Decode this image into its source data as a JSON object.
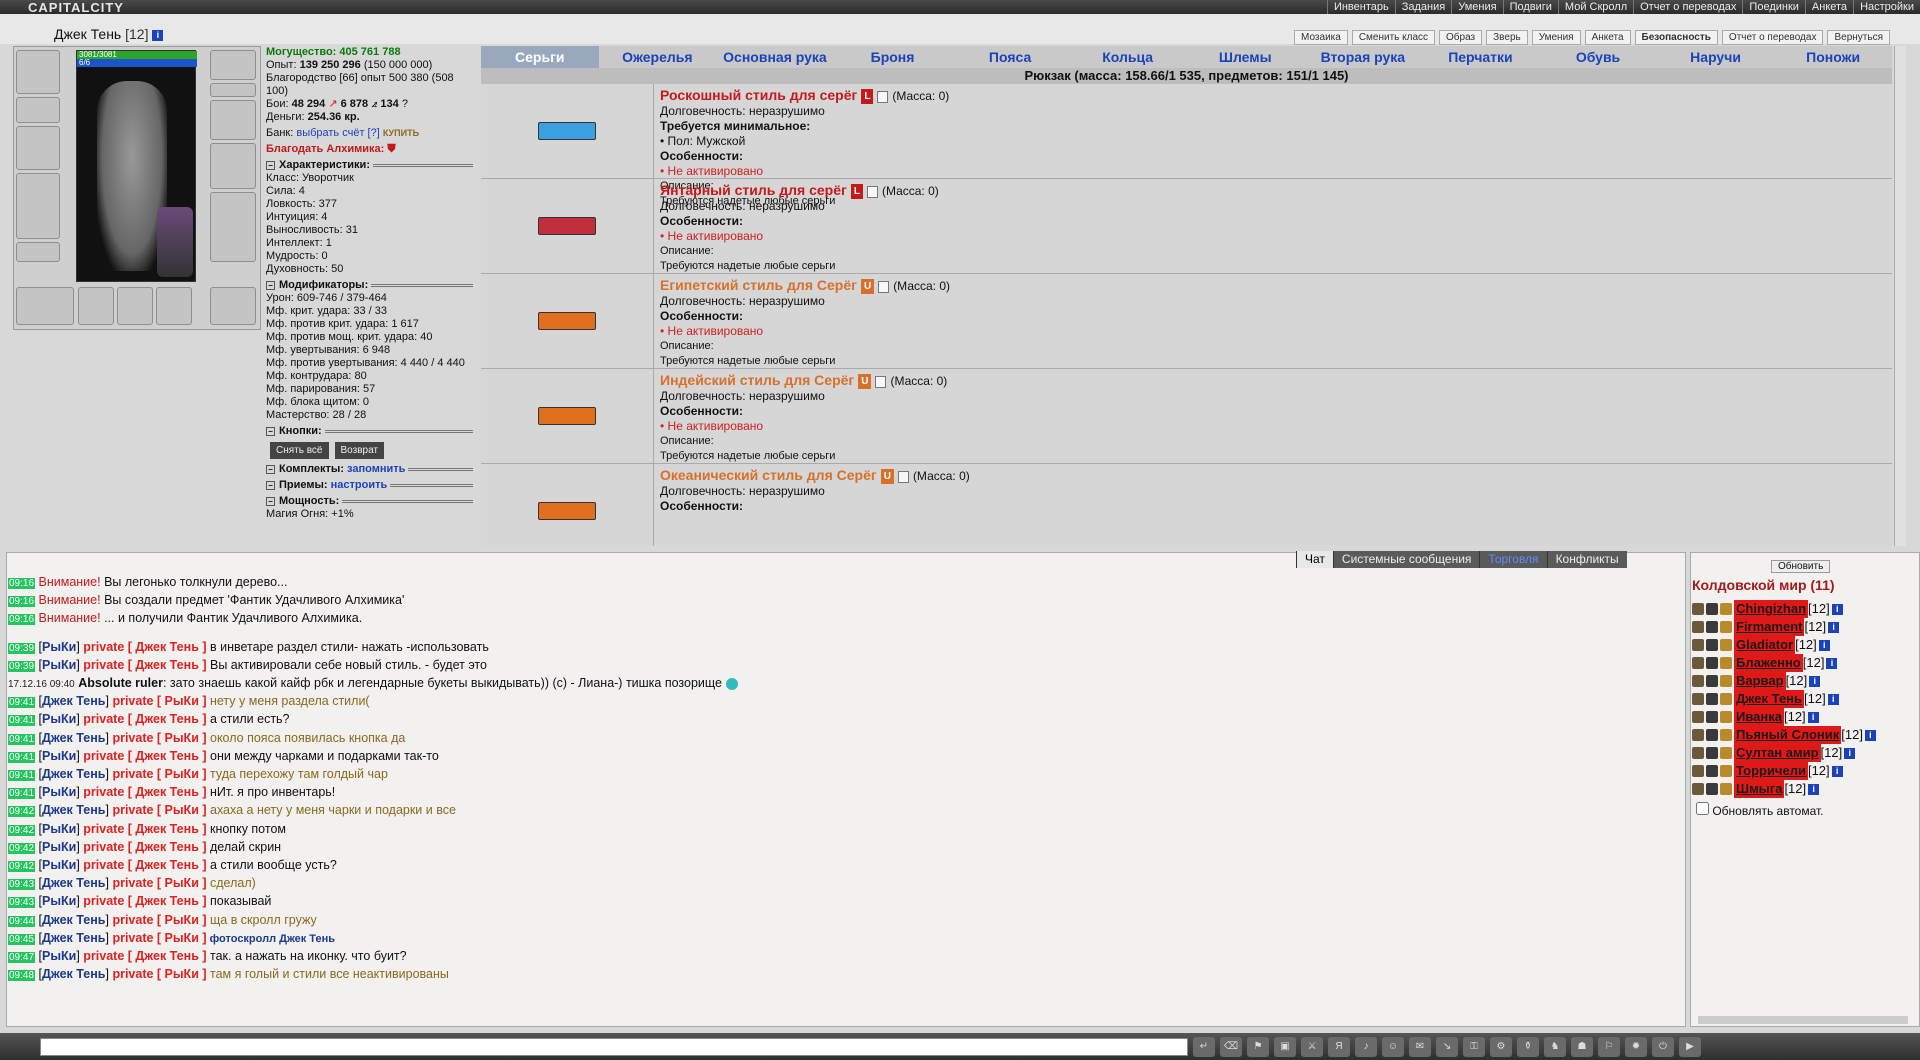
{
  "app": {
    "logo": "CAPITALCITY"
  },
  "topnav": [
    "Инвентарь",
    "Задания",
    "Умения",
    "Подвиги",
    "Мой Скролл",
    "Отчет о переводах",
    "Поединки",
    "Анкета",
    "Настройки"
  ],
  "character": {
    "name": "Джек Тень",
    "level": "[12]",
    "hp": "3081/3081",
    "mp": "6/6"
  },
  "actions": [
    "Мозаика",
    "Сменить класс",
    "Образ",
    "Зверь",
    "Умения",
    "Анкета",
    "Безопасность",
    "Отчет о переводах",
    "Вернуться"
  ],
  "stats": {
    "power": "Могущество: 405 761 788",
    "exp_label": "Опыт:",
    "exp": "139 250 296",
    "exp_next": "(150 000 000)",
    "valor_line": "Благородство [66] опыт 500 380 (508 100)",
    "fights_label": "Бои:",
    "fights_win": "48 294",
    "fights_lose": "6 878",
    "fights_draw": "134",
    "money_label": "Деньги:",
    "money": "254.36 кр.",
    "bank_label": "Банк:",
    "bank_link": "выбрать счёт",
    "bank_help": "[?]",
    "bank_buy": "КУПИТЬ",
    "alchemist": "Благодать Алхимика:"
  },
  "sections": {
    "chars": "Характеристики:",
    "mods": "Модификаторы:",
    "buttons": "Кнопки:",
    "sets": "Комплекты:",
    "sets_link": "запомнить",
    "moves": "Приемы:",
    "moves_link": "настроить",
    "power": "Мощность:"
  },
  "chars": [
    "Класс: Уворотчик",
    "Сила: 4",
    "Ловкость: 377",
    "Интуиция: 4",
    "Выносливость: 31",
    "Интеллект: 1",
    "Мудрость: 0",
    "Духовность: 50"
  ],
  "mods": [
    "Урон: 609-746 / 379-464",
    "Мф. крит. удара: 33 / 33",
    "Мф. против крит. удара: 1 617",
    "Мф. против мощ. крит. удара: 40",
    "Мф. увертывания: 6 948",
    "Мф. против увертывания: 4 440 / 4 440",
    "Мф. контрудара: 80",
    "Мф. парирования: 57",
    "Мф. блока щитом: 0",
    "Мастерство: 28 / 28"
  ],
  "btns": {
    "remove_all": "Снять всё",
    "return": "Возврат"
  },
  "power_line": "Магия Огня: +1%",
  "tabs": [
    "Серьги",
    "Ожерелья",
    "Основная рука",
    "Броня",
    "Пояса",
    "Кольца",
    "Шлемы",
    "Вторая рука",
    "Перчатки",
    "Обувь",
    "Наручи",
    "Поножи"
  ],
  "bag": "Рюкзак (масса: 158.66/1 535, предметов: 151/1 145)",
  "items": [
    {
      "title": "Роскошный стиль для серёг",
      "badge": "L",
      "mass": "(Масса: 0)",
      "dur": "Долговечность: неразрушимо",
      "req_h": "Требуется минимальное:",
      "req": "• Пол: Мужской",
      "feat_h": "Особенности:",
      "feat": "• Не активировано",
      "desc_h": "Описание:",
      "desc": "Требуются надетые любые серьги",
      "color": "#3aa0e0"
    },
    {
      "title": "Янтарный стиль для серёг",
      "badge": "L",
      "mass": "(Масса: 0)",
      "dur": "Долговечность: неразрушимо",
      "feat_h": "Особенности:",
      "feat": "• Не активировано",
      "desc_h": "Описание:",
      "desc": "Требуются надетые любые серьги",
      "color": "#c0303a"
    },
    {
      "title": "Египетский стиль для Серёг",
      "badge": "U",
      "mass": "(Масса: 0)",
      "dur": "Долговечность: неразрушимо",
      "feat_h": "Особенности:",
      "feat": "• Не активировано",
      "desc_h": "Описание:",
      "desc": "Требуются надетые любые серьги",
      "color": "#e07020"
    },
    {
      "title": "Индейский стиль для Серёг",
      "badge": "U",
      "mass": "(Масса: 0)",
      "dur": "Долговечность: неразрушимо",
      "feat_h": "Особенности:",
      "feat": "• Не активировано",
      "desc_h": "Описание:",
      "desc": "Требуются надетые любые серьги",
      "color": "#e07020"
    },
    {
      "title": "Океанический стиль для Серёг",
      "badge": "U",
      "mass": "(Масса: 0)",
      "dur": "Долговечность: неразрушимо",
      "feat_h": "Особенности:",
      "color": "#e07020"
    }
  ],
  "chat_tabs": [
    "Чат",
    "Системные сообщения",
    "Торговля",
    "Конфликты"
  ],
  "chat": [
    {
      "t": "09:16",
      "kind": "sys",
      "a": "Внимание!",
      "m": " Вы легонько толкнули дерево..."
    },
    {
      "t": "09:16",
      "kind": "sys",
      "a": "Внимание!",
      "m": " Вы создали предмет 'Фантик Удачливого Алхимика'"
    },
    {
      "t": "09:16",
      "kind": "sys",
      "a": "Внимание!",
      "m": " ... и получили Фантик Удачливого Алхимика."
    },
    {
      "t": "09:39",
      "kind": "in",
      "a": "РыКи",
      "p": "Джек Тень",
      "m": " в инветаре раздел стили- нажать -использовать"
    },
    {
      "t": "09:39",
      "kind": "in",
      "a": "РыКи",
      "p": "Джек Тень",
      "m": " Вы активировали себе новый стиль. - будет это"
    },
    {
      "t": "17.12.16 09:40",
      "kind": "glob",
      "a": "Absolute ruler",
      "m": ": зато знаешь какой кайф рбк и легендарные букеты выкидывать)) (с) - Лиана-) тишка позорище"
    },
    {
      "t": "09:41",
      "kind": "out",
      "a": "Джек Тень",
      "p": "РыКи",
      "m": " нету у меня раздела стили("
    },
    {
      "t": "09:41",
      "kind": "in",
      "a": "РыКи",
      "p": "Джек Тень",
      "m": " а стили есть?"
    },
    {
      "t": "09:41",
      "kind": "out",
      "a": "Джек Тень",
      "p": "РыКи",
      "m": " около пояса появилась кнопка да"
    },
    {
      "t": "09:41",
      "kind": "in",
      "a": "РыКи",
      "p": "Джек Тень",
      "m": " они между чарками и подарками так-то"
    },
    {
      "t": "09:41",
      "kind": "out",
      "a": "Джек Тень",
      "p": "РыКи",
      "m": " туда перехожу там голдый чар"
    },
    {
      "t": "09:41",
      "kind": "in",
      "a": "РыКи",
      "p": "Джек Тень",
      "m": " нИт. я про инвентарь!"
    },
    {
      "t": "09:42",
      "kind": "out",
      "a": "Джек Тень",
      "p": "РыКи",
      "m": " ахаха а нету у меня чарки и подарки и все"
    },
    {
      "t": "09:42",
      "kind": "in",
      "a": "РыКи",
      "p": "Джек Тень",
      "m": " кнопку потом"
    },
    {
      "t": "09:42",
      "kind": "in",
      "a": "РыКи",
      "p": "Джек Тень",
      "m": " делай скрин"
    },
    {
      "t": "09:42",
      "kind": "in",
      "a": "РыКи",
      "p": "Джек Тень",
      "m": " а стили вообще усть?"
    },
    {
      "t": "09:43",
      "kind": "out",
      "a": "Джек Тень",
      "p": "РыКи",
      "m": " сделал)"
    },
    {
      "t": "09:43",
      "kind": "in",
      "a": "РыКи",
      "p": "Джек Тень",
      "m": " показывай"
    },
    {
      "t": "09:44",
      "kind": "out",
      "a": "Джек Тень",
      "p": "РыКи",
      "m": " ща в скролл гружу"
    },
    {
      "t": "09:45",
      "kind": "outb",
      "a": "Джек Тень",
      "p": "РыКи",
      "m": " фотоскролл Джек Тень"
    },
    {
      "t": "09:47",
      "kind": "in",
      "a": "РыКи",
      "p": "Джек Тень",
      "m": " так. а нажать на иконку. что буит?"
    },
    {
      "t": "09:48",
      "kind": "out",
      "a": "Джек Тень",
      "p": "РыКи",
      "m": " там я голый и стили все неактивированы"
    }
  ],
  "online": {
    "refresh": "Обновить",
    "title": "Колдовской мир (11)",
    "auto": "Обновлять автомат.",
    "users": [
      {
        "n": "Chingizhan",
        "l": "[12]"
      },
      {
        "n": "Firmament",
        "l": "[12]"
      },
      {
        "n": "Gladiator",
        "l": "[12]"
      },
      {
        "n": "Блаженно",
        "l": "[12]"
      },
      {
        "n": "Варвар",
        "l": "[12]"
      },
      {
        "n": "Джек Тень",
        "l": "[12]"
      },
      {
        "n": "Иванка",
        "l": "[12]"
      },
      {
        "n": "Пьяный Слоник",
        "l": "[12]"
      },
      {
        "n": "Султан амир",
        "l": "[12]"
      },
      {
        "n": "Торричели",
        "l": "[12]"
      },
      {
        "n": "Шмыга",
        "l": "[12]"
      }
    ]
  }
}
